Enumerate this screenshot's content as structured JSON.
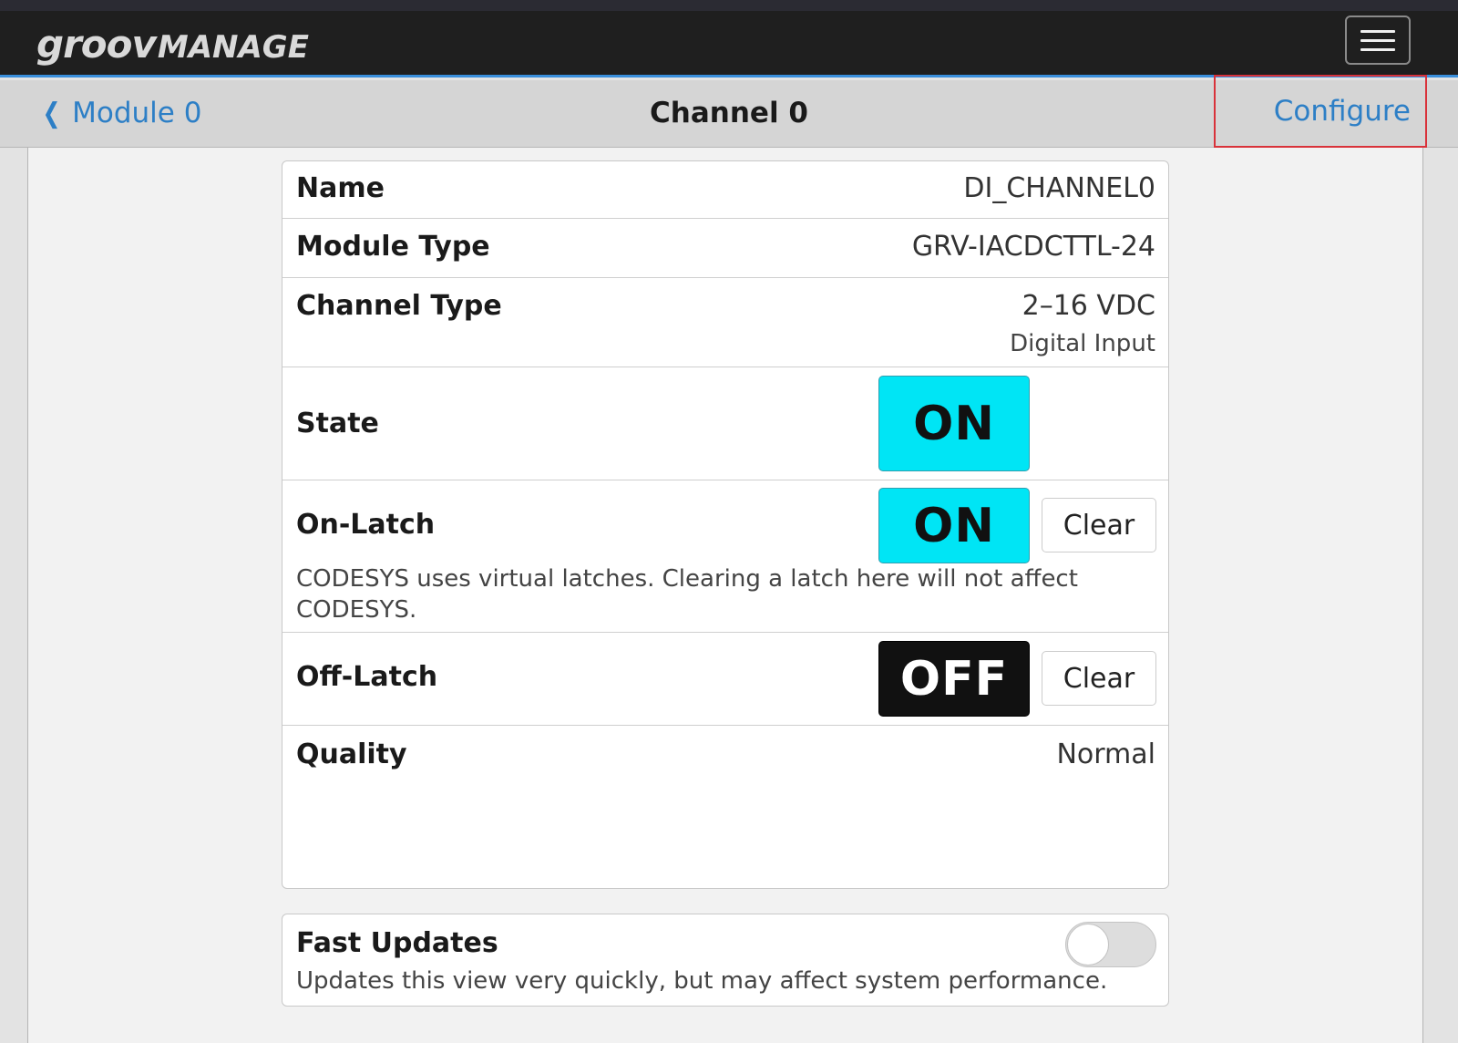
{
  "app": {
    "logo_part1": "groov",
    "logo_part2": "MANAGE"
  },
  "header": {
    "back_label": "Module 0",
    "title": "Channel 0",
    "configure_label": "Configure"
  },
  "channel": {
    "name_label": "Name",
    "name_value": "DI_CHANNEL0",
    "module_type_label": "Module Type",
    "module_type_value": "GRV-IACDCTTL-24",
    "channel_type_label": "Channel Type",
    "channel_type_value": "2–16 VDC",
    "channel_type_sub": "Digital Input",
    "state_label": "State",
    "state_value": "ON",
    "on_latch_label": "On-Latch",
    "on_latch_value": "ON",
    "on_latch_clear": "Clear",
    "on_latch_note": "CODESYS uses virtual latches. Clearing a latch here will not affect CODESYS.",
    "off_latch_label": "Off-Latch",
    "off_latch_value": "OFF",
    "off_latch_clear": "Clear",
    "quality_label": "Quality",
    "quality_value": "Normal"
  },
  "fast_updates": {
    "label": "Fast Updates",
    "description": "Updates this view very quickly, but may affect system performance.",
    "enabled": false
  },
  "colors": {
    "on": "#00e5f5",
    "off": "#111111",
    "link": "#2d7fc6",
    "accent_line": "#3a8fdc"
  }
}
